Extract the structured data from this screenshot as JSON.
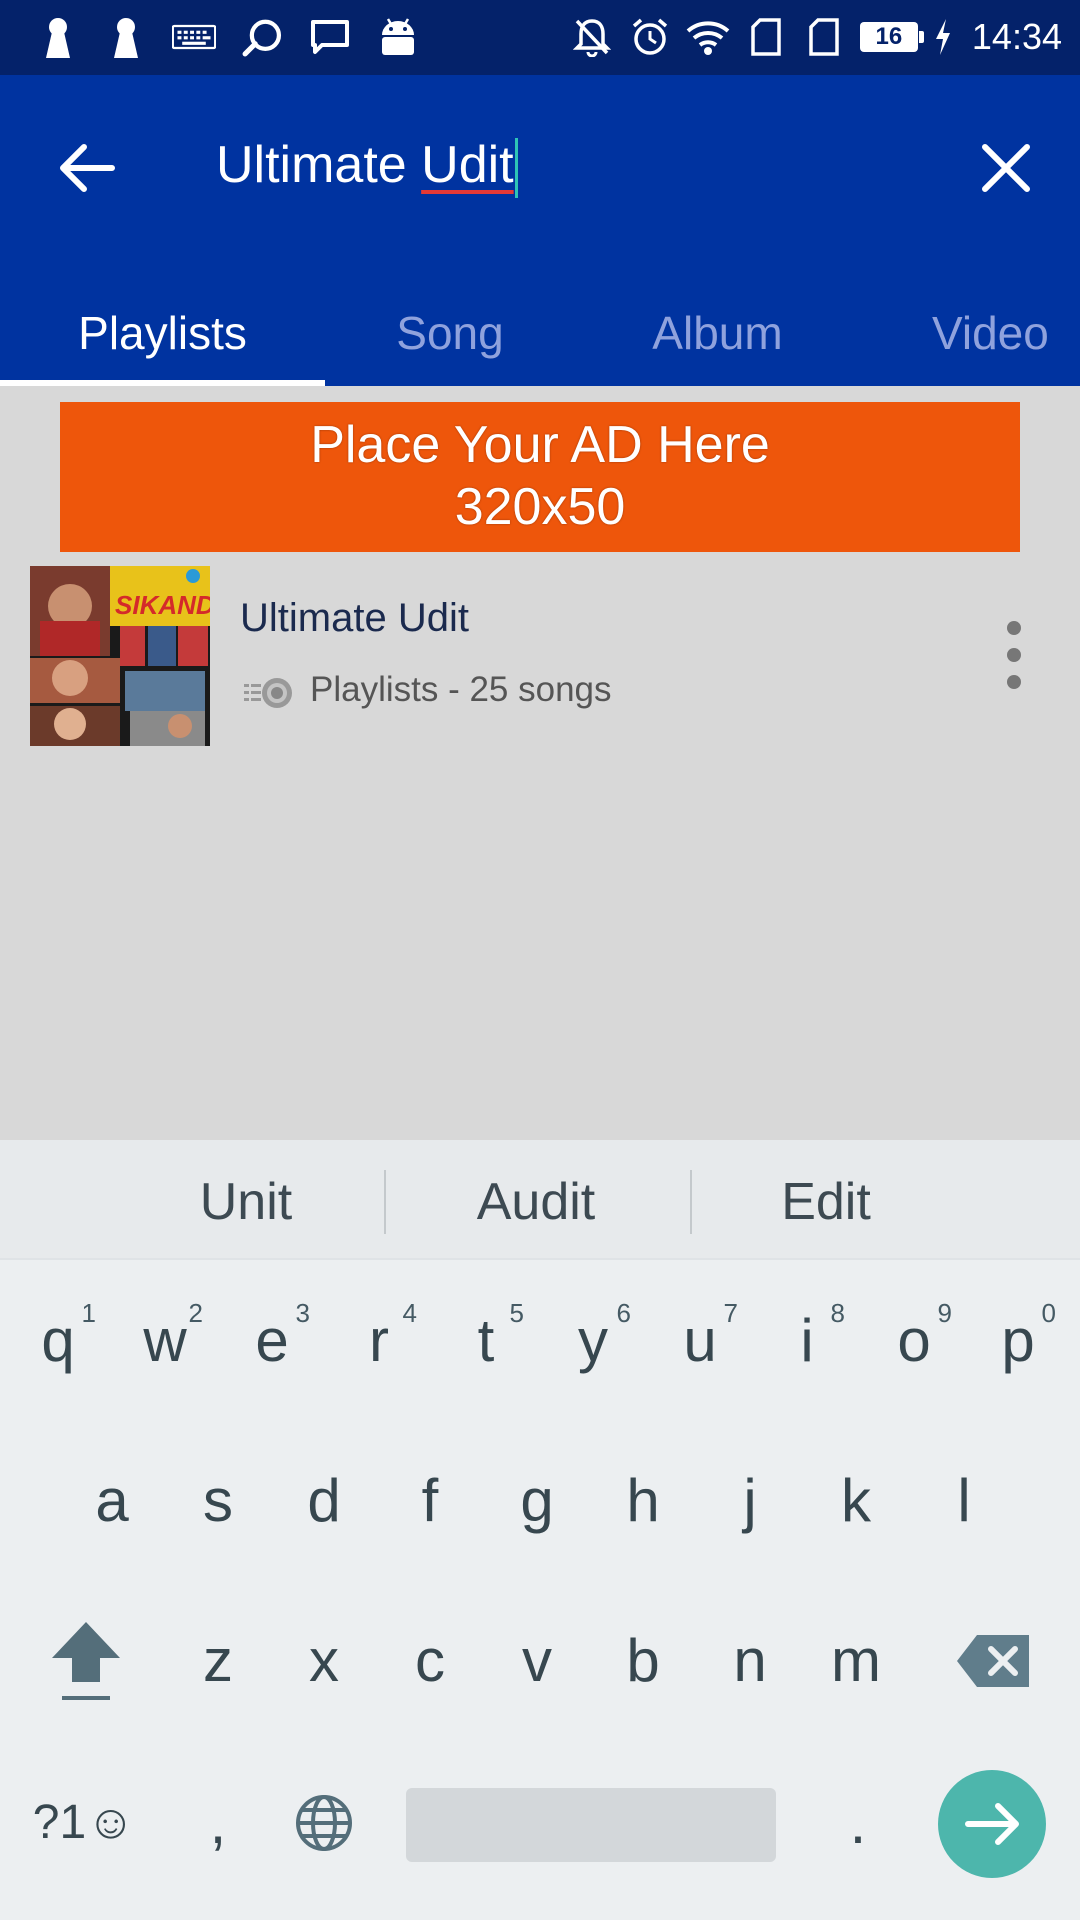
{
  "status_bar": {
    "time": "14:34",
    "battery": "16",
    "left_icons": [
      "keyhole-icon",
      "keyhole-icon",
      "keyboard-icon",
      "search-app-icon",
      "message-icon",
      "android-icon"
    ],
    "right_icons": [
      "notifications-off-icon",
      "alarm-icon",
      "wifi-icon",
      "sim-icon",
      "sim-icon",
      "battery-icon",
      "charging-icon"
    ]
  },
  "search": {
    "query_prefix": "Ultimate ",
    "query_underlined": "Udit"
  },
  "tabs": [
    {
      "label": "Playlists",
      "active": true
    },
    {
      "label": "Song",
      "active": false
    },
    {
      "label": "Album",
      "active": false
    },
    {
      "label": "Video",
      "active": false
    }
  ],
  "ad": {
    "line1": "Place Your AD Here",
    "line2": "320x50",
    "color": "#ee560b"
  },
  "results": [
    {
      "title": "Ultimate Udit",
      "subtitle": "Playlists - 25 songs"
    }
  ],
  "keyboard": {
    "suggestions": [
      "Unit",
      "Audit",
      "Edit"
    ],
    "row1": [
      "q",
      "w",
      "e",
      "r",
      "t",
      "y",
      "u",
      "i",
      "o",
      "p"
    ],
    "row1_hints": [
      "1",
      "2",
      "3",
      "4",
      "5",
      "6",
      "7",
      "8",
      "9",
      "0"
    ],
    "row2": [
      "a",
      "s",
      "d",
      "f",
      "g",
      "h",
      "j",
      "k",
      "l"
    ],
    "row3": [
      "z",
      "x",
      "c",
      "v",
      "b",
      "n",
      "m"
    ],
    "symbols_label": "?1☺",
    "comma": ",",
    "period": "."
  },
  "colors": {
    "status_bar": "#04226a",
    "app_bar": "#0033a0",
    "enter_key": "#4db6ac"
  }
}
